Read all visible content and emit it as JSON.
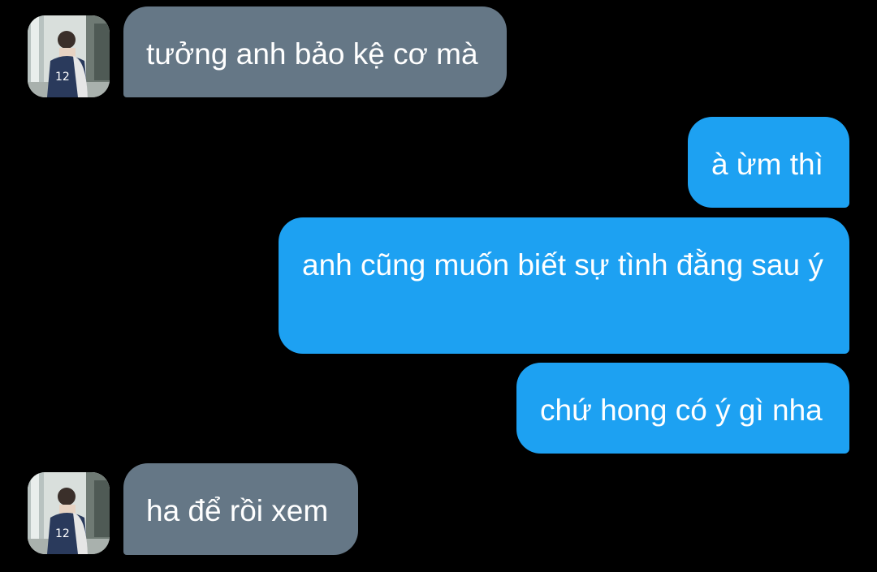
{
  "conversation": {
    "messages": [
      {
        "direction": "incoming",
        "text": "tưởng anh bảo kệ cơ mà"
      },
      {
        "direction": "outgoing",
        "text": "à ừm thì"
      },
      {
        "direction": "outgoing",
        "text": "anh cũng muốn biết sự tình đằng sau ý"
      },
      {
        "direction": "outgoing",
        "text": "chứ hong có ý gì nha"
      },
      {
        "direction": "incoming",
        "text": "ha để rồi xem"
      }
    ]
  },
  "colors": {
    "background": "#000000",
    "incoming_bubble": "#657786",
    "outgoing_bubble": "#1da1f2",
    "text": "#ffffff"
  },
  "icons": {
    "avatar": "contact-avatar-photo"
  }
}
